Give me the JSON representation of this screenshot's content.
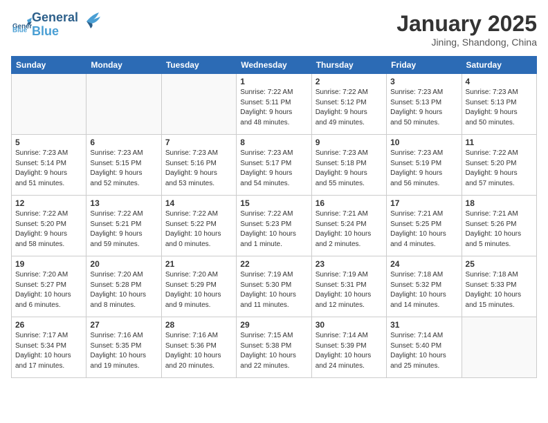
{
  "header": {
    "logo": "GeneralBlue",
    "month": "January 2025",
    "location": "Jining, Shandong, China"
  },
  "weekdays": [
    "Sunday",
    "Monday",
    "Tuesday",
    "Wednesday",
    "Thursday",
    "Friday",
    "Saturday"
  ],
  "weeks": [
    [
      {
        "day": "",
        "info": ""
      },
      {
        "day": "",
        "info": ""
      },
      {
        "day": "",
        "info": ""
      },
      {
        "day": "1",
        "info": "Sunrise: 7:22 AM\nSunset: 5:11 PM\nDaylight: 9 hours\nand 48 minutes."
      },
      {
        "day": "2",
        "info": "Sunrise: 7:22 AM\nSunset: 5:12 PM\nDaylight: 9 hours\nand 49 minutes."
      },
      {
        "day": "3",
        "info": "Sunrise: 7:23 AM\nSunset: 5:13 PM\nDaylight: 9 hours\nand 50 minutes."
      },
      {
        "day": "4",
        "info": "Sunrise: 7:23 AM\nSunset: 5:13 PM\nDaylight: 9 hours\nand 50 minutes."
      }
    ],
    [
      {
        "day": "5",
        "info": "Sunrise: 7:23 AM\nSunset: 5:14 PM\nDaylight: 9 hours\nand 51 minutes."
      },
      {
        "day": "6",
        "info": "Sunrise: 7:23 AM\nSunset: 5:15 PM\nDaylight: 9 hours\nand 52 minutes."
      },
      {
        "day": "7",
        "info": "Sunrise: 7:23 AM\nSunset: 5:16 PM\nDaylight: 9 hours\nand 53 minutes."
      },
      {
        "day": "8",
        "info": "Sunrise: 7:23 AM\nSunset: 5:17 PM\nDaylight: 9 hours\nand 54 minutes."
      },
      {
        "day": "9",
        "info": "Sunrise: 7:23 AM\nSunset: 5:18 PM\nDaylight: 9 hours\nand 55 minutes."
      },
      {
        "day": "10",
        "info": "Sunrise: 7:23 AM\nSunset: 5:19 PM\nDaylight: 9 hours\nand 56 minutes."
      },
      {
        "day": "11",
        "info": "Sunrise: 7:22 AM\nSunset: 5:20 PM\nDaylight: 9 hours\nand 57 minutes."
      }
    ],
    [
      {
        "day": "12",
        "info": "Sunrise: 7:22 AM\nSunset: 5:20 PM\nDaylight: 9 hours\nand 58 minutes."
      },
      {
        "day": "13",
        "info": "Sunrise: 7:22 AM\nSunset: 5:21 PM\nDaylight: 9 hours\nand 59 minutes."
      },
      {
        "day": "14",
        "info": "Sunrise: 7:22 AM\nSunset: 5:22 PM\nDaylight: 10 hours\nand 0 minutes."
      },
      {
        "day": "15",
        "info": "Sunrise: 7:22 AM\nSunset: 5:23 PM\nDaylight: 10 hours\nand 1 minute."
      },
      {
        "day": "16",
        "info": "Sunrise: 7:21 AM\nSunset: 5:24 PM\nDaylight: 10 hours\nand 2 minutes."
      },
      {
        "day": "17",
        "info": "Sunrise: 7:21 AM\nSunset: 5:25 PM\nDaylight: 10 hours\nand 4 minutes."
      },
      {
        "day": "18",
        "info": "Sunrise: 7:21 AM\nSunset: 5:26 PM\nDaylight: 10 hours\nand 5 minutes."
      }
    ],
    [
      {
        "day": "19",
        "info": "Sunrise: 7:20 AM\nSunset: 5:27 PM\nDaylight: 10 hours\nand 6 minutes."
      },
      {
        "day": "20",
        "info": "Sunrise: 7:20 AM\nSunset: 5:28 PM\nDaylight: 10 hours\nand 8 minutes."
      },
      {
        "day": "21",
        "info": "Sunrise: 7:20 AM\nSunset: 5:29 PM\nDaylight: 10 hours\nand 9 minutes."
      },
      {
        "day": "22",
        "info": "Sunrise: 7:19 AM\nSunset: 5:30 PM\nDaylight: 10 hours\nand 11 minutes."
      },
      {
        "day": "23",
        "info": "Sunrise: 7:19 AM\nSunset: 5:31 PM\nDaylight: 10 hours\nand 12 minutes."
      },
      {
        "day": "24",
        "info": "Sunrise: 7:18 AM\nSunset: 5:32 PM\nDaylight: 10 hours\nand 14 minutes."
      },
      {
        "day": "25",
        "info": "Sunrise: 7:18 AM\nSunset: 5:33 PM\nDaylight: 10 hours\nand 15 minutes."
      }
    ],
    [
      {
        "day": "26",
        "info": "Sunrise: 7:17 AM\nSunset: 5:34 PM\nDaylight: 10 hours\nand 17 minutes."
      },
      {
        "day": "27",
        "info": "Sunrise: 7:16 AM\nSunset: 5:35 PM\nDaylight: 10 hours\nand 19 minutes."
      },
      {
        "day": "28",
        "info": "Sunrise: 7:16 AM\nSunset: 5:36 PM\nDaylight: 10 hours\nand 20 minutes."
      },
      {
        "day": "29",
        "info": "Sunrise: 7:15 AM\nSunset: 5:38 PM\nDaylight: 10 hours\nand 22 minutes."
      },
      {
        "day": "30",
        "info": "Sunrise: 7:14 AM\nSunset: 5:39 PM\nDaylight: 10 hours\nand 24 minutes."
      },
      {
        "day": "31",
        "info": "Sunrise: 7:14 AM\nSunset: 5:40 PM\nDaylight: 10 hours\nand 25 minutes."
      },
      {
        "day": "",
        "info": ""
      }
    ]
  ]
}
